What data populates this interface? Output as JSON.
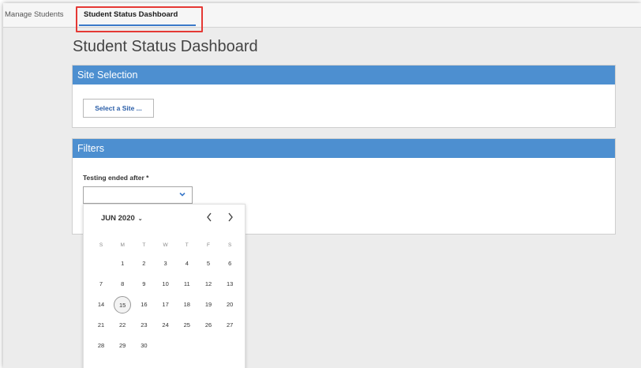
{
  "tabs": {
    "manage_students": "Manage Students",
    "student_status_dashboard": "Student Status Dashboard"
  },
  "page": {
    "title": "Student Status Dashboard"
  },
  "site_selection": {
    "heading": "Site Selection",
    "button_label": "Select a Site ..."
  },
  "filters": {
    "heading": "Filters",
    "testing_ended_label": "Testing ended after *",
    "date_value": ""
  },
  "calendar": {
    "month_label": "JUN 2020",
    "weekdays": [
      "S",
      "M",
      "T",
      "W",
      "T",
      "F",
      "S"
    ],
    "days": [
      "1",
      "2",
      "3",
      "4",
      "5",
      "6",
      "7",
      "8",
      "9",
      "10",
      "11",
      "12",
      "13",
      "14",
      "15",
      "16",
      "17",
      "18",
      "19",
      "20",
      "21",
      "22",
      "23",
      "24",
      "25",
      "26",
      "27",
      "28",
      "29",
      "30"
    ],
    "first_weekday_index": 1,
    "selected_day": "15"
  },
  "colors": {
    "accent": "#4d8fd0",
    "link": "#2a5ea8",
    "highlight_box": "#e53935"
  },
  "icons": {
    "month_dropdown": "chevron-down-icon",
    "date_dropdown": "chevron-down-icon",
    "prev": "chevron-left-icon",
    "next": "chevron-right-icon"
  }
}
